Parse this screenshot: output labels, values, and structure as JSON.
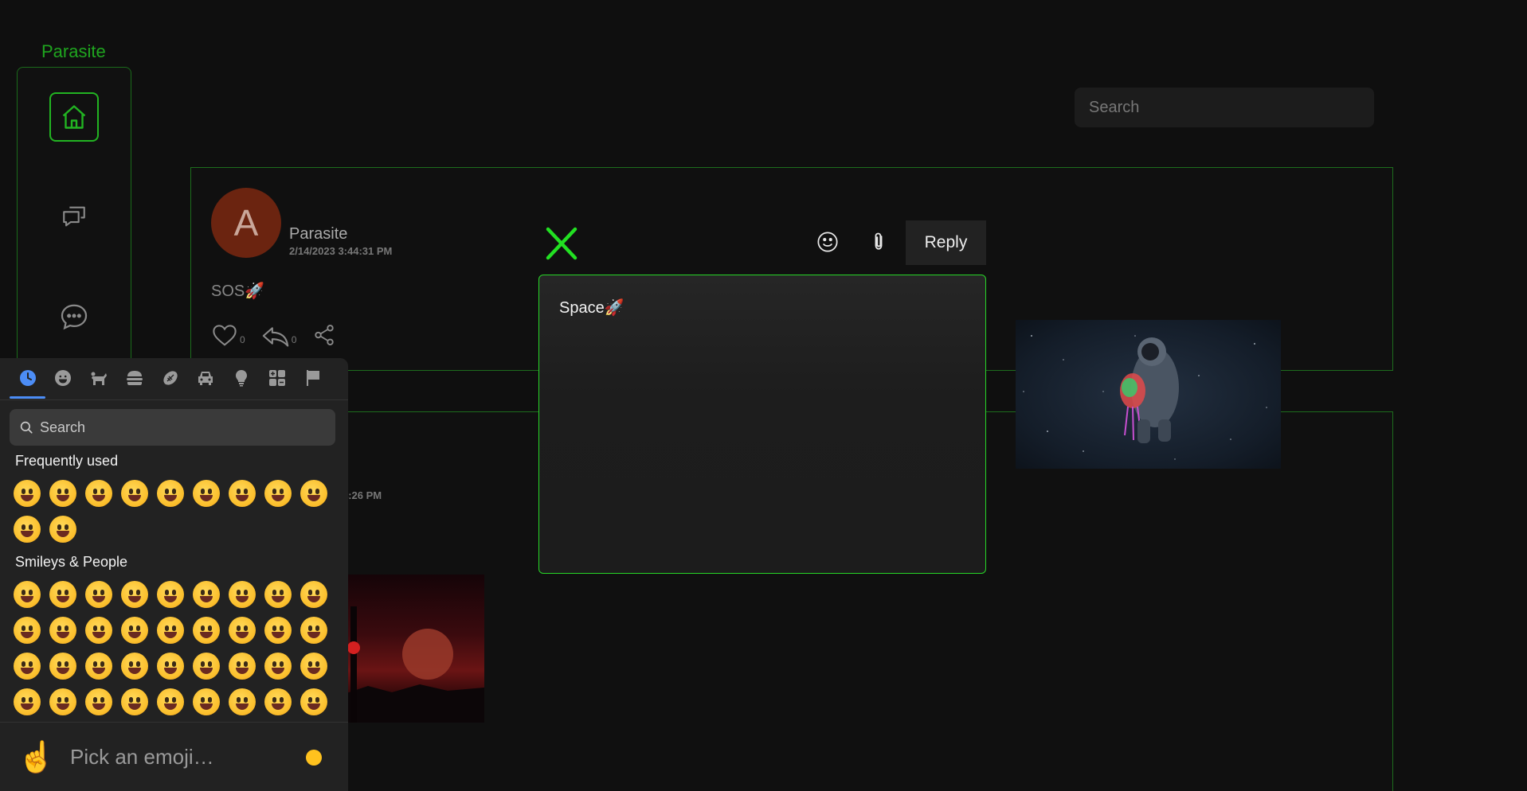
{
  "app": {
    "brand": "Parasite"
  },
  "search": {
    "placeholder": "Search"
  },
  "posts": [
    {
      "avatar_letter": "A",
      "author": "Parasite",
      "timestamp": "2/14/2023 3:44:31 PM",
      "text": "SOS🚀",
      "likes": "0",
      "replies": "0"
    },
    {
      "timestamp_partial": "4:26 PM"
    }
  ],
  "reply": {
    "button_label": "Reply",
    "text": "Space🚀"
  },
  "emoji_picker": {
    "search_placeholder": "Search",
    "frequently_used_heading": "Frequently used",
    "smileys_heading": "Smileys & People",
    "preview_label": "Pick an emoji…",
    "preview_emoji": "☝️",
    "categories": [
      "recent-icon",
      "smiley-icon",
      "animal-icon",
      "food-icon",
      "activity-icon",
      "travel-icon",
      "objects-icon",
      "symbols-icon",
      "flags-icon"
    ],
    "frequent": [
      "😆",
      "👍",
      "😍",
      "😀",
      "😘",
      "😱",
      "😋",
      "😂",
      "😅",
      "🚀",
      "🤣"
    ],
    "smileys": [
      "😀",
      "😃",
      "😄",
      "😁",
      "😆",
      "😅",
      "🤣",
      "😂",
      "🙂",
      "🙃",
      "🫠",
      "😉",
      "😊",
      "😇",
      "🥰",
      "😍",
      "🤩",
      "😘",
      "😗",
      "☺️",
      "😚",
      "😙",
      "🥲",
      "😋",
      "😛",
      "😜",
      "🤪",
      "😝",
      "🤑",
      "🤗",
      "🤭",
      "🫢",
      "🫣",
      "🤫",
      "🤔",
      "🫡"
    ]
  },
  "colors": {
    "accent": "#22c422",
    "brand_green": "#1fa51f",
    "panel": "#222222"
  }
}
